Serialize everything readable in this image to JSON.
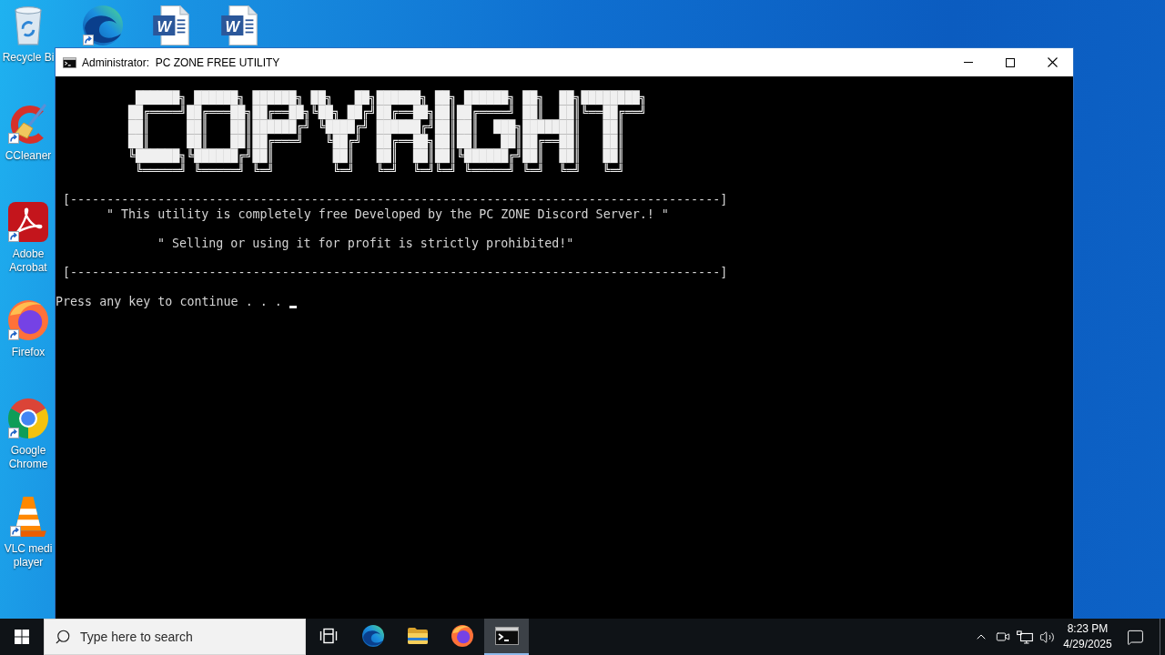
{
  "desktop": {
    "icon_columns": [
      [
        {
          "kind": "recycle-bin",
          "label": "Recycle Bi",
          "shortcut": false
        },
        {
          "kind": "ccleaner",
          "label": "CCleaner",
          "shortcut": true
        },
        {
          "kind": "acrobat",
          "label": "Adobe Acrobat",
          "shortcut": true
        },
        {
          "kind": "firefox",
          "label": "Firefox",
          "shortcut": true
        },
        {
          "kind": "chrome",
          "label": "Google Chrome",
          "shortcut": true
        },
        {
          "kind": "vlc",
          "label": "VLC medi player",
          "shortcut": true
        }
      ],
      [
        {
          "kind": "edge",
          "shortcut": true
        }
      ],
      [
        {
          "kind": "word-document",
          "mark": "W",
          "shortcut": false
        }
      ],
      [
        {
          "kind": "word-document",
          "mark": "W",
          "shortcut": false
        }
      ]
    ]
  },
  "window": {
    "title": "Administrator:  PC ZONE FREE UTILITY",
    "console": {
      "banner": [
        " ██████╗ ██████╗ ██████╗ ██╗   ██╗██████╗ ██╗ ██████╗ ██╗  ██╗████████╗",
        "██╔════╝██╔═══██╗██╔══██╗╚██╗ ██╔╝██╔══██╗██║██╔════╝ ██║  ██║╚══██╔══╝",
        "██║     ██║   ██║██████╔╝ ╚████╔╝ ██████╔╝██║██║  ███╗███████║   ██║",
        "██║     ██║   ██║██╔═══╝   ╚██╔╝  ██╔══██╗██║██║   ██║██╔══██║   ██║",
        "╚██████╗╚██████╔╝██║        ██║   ██║  ██║██║╚██████╔╝██║  ██║   ██║",
        " ╚═════╝ ╚═════╝ ╚═╝        ╚═╝   ╚═╝  ╚═╝╚═╝ ╚═════╝ ╚═╝  ╚═╝   ╚═╝"
      ],
      "rule_top": "[-----------------------------------------------------------------------------------------]",
      "notice": [
        "\" This utility is completely free Developed by the PC ZONE Discord Server.! \"",
        "\" Selling or using it for profit is strictly prohibited!\""
      ],
      "rule_bottom": "[-----------------------------------------------------------------------------------------]",
      "prompt": "Press any key to continue . . .",
      "cursor_visible": true
    }
  },
  "taskbar": {
    "search": {
      "placeholder": "Type here to search"
    },
    "buttons": [
      {
        "kind": "task-view",
        "selected": false
      },
      {
        "kind": "edge",
        "selected": false
      },
      {
        "kind": "file-explorer",
        "selected": false
      },
      {
        "kind": "firefox",
        "selected": false
      },
      {
        "kind": "terminal",
        "selected": true
      }
    ],
    "clock": {
      "time": "8:23 PM",
      "date": "4/29/2025"
    }
  }
}
